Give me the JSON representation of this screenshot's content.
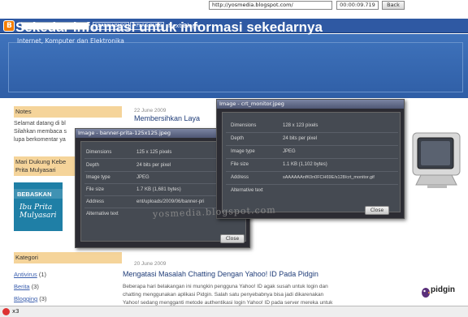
{
  "browser": {
    "url": "http://yosmedia.blogspot.com/",
    "timer": "00:00:09.719",
    "back_label": "Back"
  },
  "navbar": {
    "search_blog_label": "SEARCH BLOG",
    "flag_blog_label": "FLAG BLOG",
    "next_blog_label": "Next Blog»",
    "logo_letter": "B"
  },
  "header": {
    "title": "Sekedar informasi untuk informasi sekedarnya",
    "description": "Internet, Komputer dan Elektronika"
  },
  "sidebar": {
    "notes_heading": "Notes",
    "notes_lines": [
      "Selamat datang di bl",
      "Silahkan membaca s",
      "lupa berkomentar ya"
    ],
    "support_heading_lines": [
      "Mari Dukung Kebe",
      "Prita Mulyasari"
    ],
    "banner_top": "BEBASKAN",
    "banner_bottom_lines": [
      "Ibu Prita",
      "Mulyasari"
    ],
    "categories_heading": "Kategori",
    "categories": [
      {
        "name": "Antivirus",
        "count": "(1)"
      },
      {
        "name": "Berita",
        "count": "(3)"
      },
      {
        "name": "Blogging",
        "count": "(3)"
      }
    ]
  },
  "posts": [
    {
      "date": "22 June 2009",
      "title": "Membersihkan Laya"
    },
    {
      "date": "20 June 2009",
      "title": "Mengatasi Masalah Chatting Dengan Yahoo! ID Pada Pidgin",
      "body_lines": [
        "Beberapa hari belakangan ini mungkin pengguna Yahoo! ID agak susah untuk login dan",
        "chatting menggunakan aplikasi Pidgin. Salah satu penyebabnya bisa jadi dikarenakan",
        "Yahoo! sedang mengganti metode authentikasi login Yahoo! ID pada server mereka untuk"
      ]
    }
  ],
  "dialog_left": {
    "title": "Image - banner-prita-125x125.jpeg",
    "rows": [
      {
        "label": "Dimensions",
        "value": "125 x 125 pixels"
      },
      {
        "label": "Depth",
        "value": "24 bits per pixel"
      },
      {
        "label": "Image type",
        "value": "JPEG"
      },
      {
        "label": "File size",
        "value": "1.7 KB (1,681 bytes)"
      },
      {
        "label": "Address",
        "value": "ent/uploads/2009/06/banner-pri"
      },
      {
        "label": "Alternative text",
        "value": ""
      }
    ],
    "close_label": "Close"
  },
  "dialog_right": {
    "title": "Image - crt_monitor.jpeg",
    "rows": [
      {
        "label": "Dimensions",
        "value": "128 x 123 pixels"
      },
      {
        "label": "Depth",
        "value": "24 bits per pixel"
      },
      {
        "label": "Image type",
        "value": "JPEG"
      },
      {
        "label": "File size",
        "value": "1.1 KB (1,102 bytes)"
      },
      {
        "label": "Address",
        "value": "sAAAAAAnfK0n0FCH69E/s128/crt_monitor.gif"
      },
      {
        "label": "Alternative text",
        "value": ""
      }
    ],
    "close_label": "Close"
  },
  "watermark": "yosmedia.blogspot.com",
  "pidgin_logo_text": "pidgin",
  "bottom_bar": {
    "text": "x3"
  },
  "colors": {
    "navbar": "#2f59a3",
    "header": "#3a6db6",
    "sidebar_heading": "#f5d49a",
    "dialog_bg": "#2c2c33"
  }
}
